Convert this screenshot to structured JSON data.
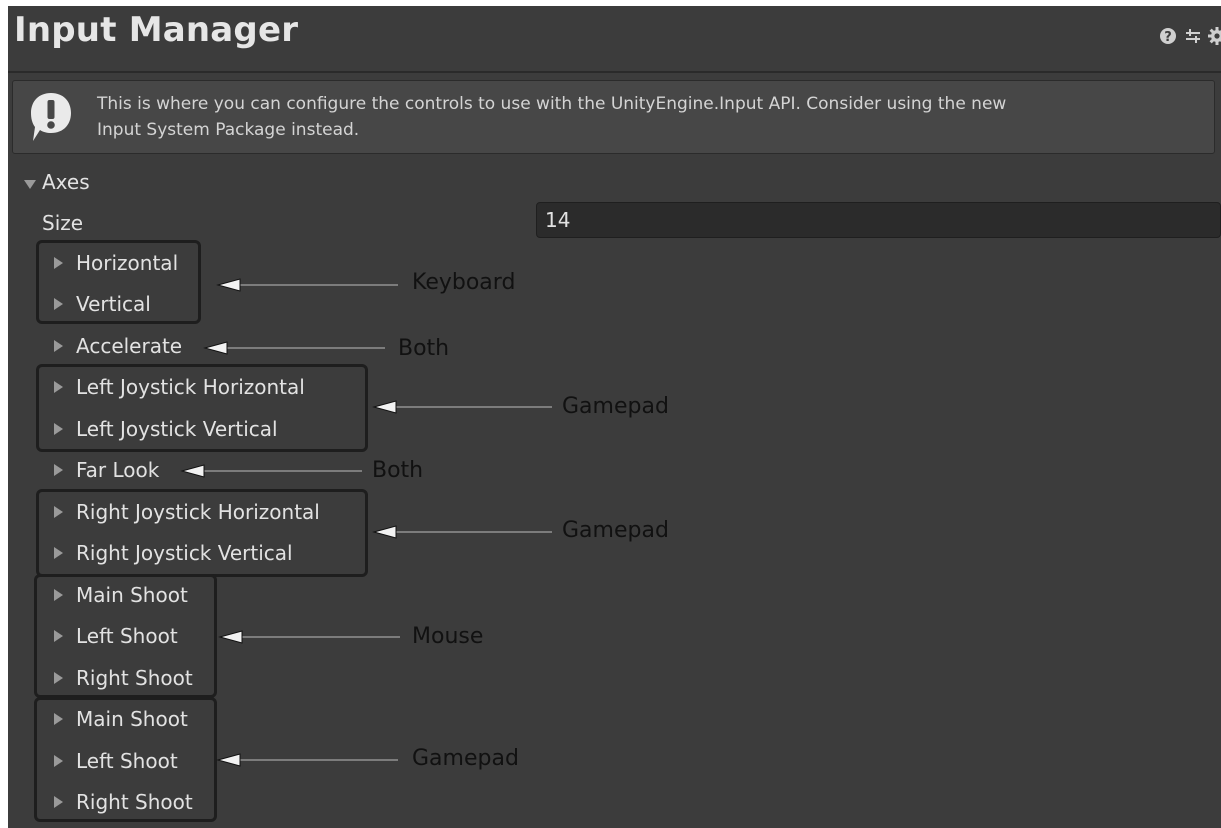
{
  "header": {
    "title": "Input Manager",
    "icons": [
      "help-icon",
      "preset-icon",
      "settings-icon"
    ]
  },
  "helpbox": {
    "icon": "warning-icon",
    "text_line1": "This is where you can configure the controls to use with the UnityEngine.Input API. Consider using the new",
    "text_line2": "Input System Package instead."
  },
  "axes": {
    "label": "Axes",
    "size_label": "Size",
    "size_value": "14",
    "items": [
      "Horizontal",
      "Vertical",
      "Accelerate",
      "Left Joystick Horizontal",
      "Left Joystick Vertical",
      "Far Look",
      "Right Joystick Horizontal",
      "Right Joystick Vertical",
      "Main Shoot",
      "Left Shoot",
      "Right Shoot",
      "Main Shoot",
      "Left Shoot",
      "Right Shoot"
    ]
  },
  "annotations": [
    "Keyboard",
    "Both",
    "Gamepad",
    "Both",
    "Gamepad",
    "Mouse",
    "Gamepad"
  ],
  "colors": {
    "panel_bg": "#3c3c3c",
    "field_bg": "#2b2b2b",
    "annotation_text": "#111111"
  }
}
